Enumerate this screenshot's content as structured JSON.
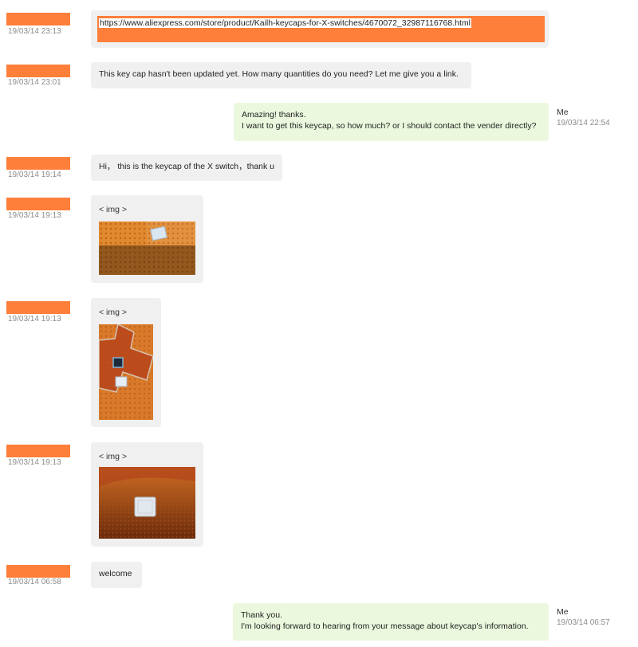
{
  "colors": {
    "redaction": "#fe7f3a",
    "incoming_bubble": "#f0f0f0",
    "outgoing_bubble": "#ebf8dd",
    "timestamp": "#8c8c8c"
  },
  "messages": [
    {
      "direction": "in",
      "time": "19/03/14 23:13",
      "text": "https://www.aliexpress.com/store/product/Kailh-keycaps-for-X-switches/4670072_32987116768.html"
    },
    {
      "direction": "in",
      "time": "19/03/14 23:01",
      "text": "This key cap hasn't been updated yet. How many quantities do you need? Let me give you a link."
    },
    {
      "direction": "out",
      "sender": "Me",
      "time": "19/03/14 22:54",
      "line1": "Amazing! thanks.",
      "line2": "I want to get this keycap, so how much? or I should contact the vender directly?"
    },
    {
      "direction": "in",
      "time": "19/03/14 19:14",
      "text": "Hi， this is the keycap of the X switch，thank u"
    },
    {
      "direction": "in",
      "time": "19/03/14 19:13",
      "text": "< img >",
      "image_icon": "photo-keycap-on-orange-mat-icon"
    },
    {
      "direction": "in",
      "time": "19/03/14 19:13",
      "text": "< img >",
      "image_icon": "photo-keycap-on-switch-icon"
    },
    {
      "direction": "in",
      "time": "19/03/14 19:13",
      "text": "< img >",
      "image_icon": "photo-keycap-closeup-icon"
    },
    {
      "direction": "in",
      "time": "19/03/14 06:58",
      "text": "welcome"
    },
    {
      "direction": "out",
      "sender": "Me",
      "time": "19/03/14 06:57",
      "line1": "Thank you.",
      "line2": "I'm looking forward to hearing from your message about keycap's information."
    }
  ]
}
